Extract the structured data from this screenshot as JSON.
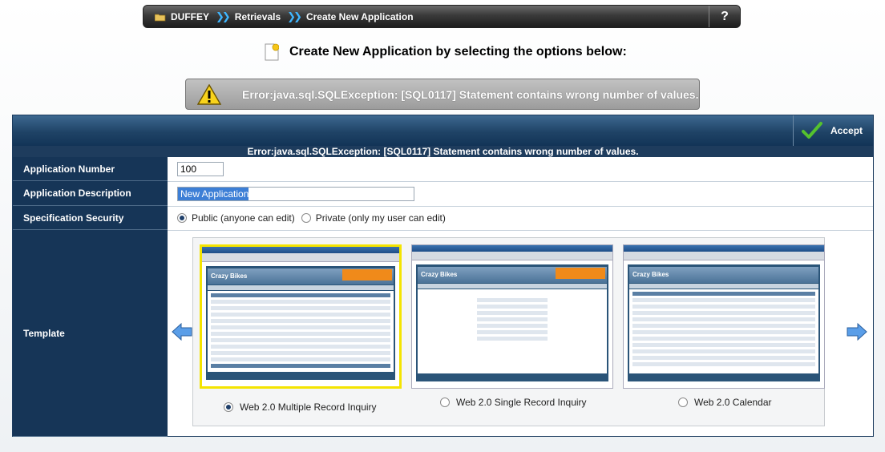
{
  "breadcrumb": {
    "items": [
      "DUFFEY",
      "Retrievals",
      "Create New Application"
    ],
    "separator": "»",
    "help_label": "?"
  },
  "page": {
    "title": "Create New Application by selecting the options below:"
  },
  "error": {
    "banner_message": "Error:java.sql.SQLException: [SQL0117] Statement contains wrong number of values.",
    "panel_message": "Error:java.sql.SQLException: [SQL0117] Statement contains wrong number of values."
  },
  "toolbar": {
    "accept_label": "Accept"
  },
  "form": {
    "app_number_label": "Application Number",
    "app_number_value": "100",
    "app_desc_label": "Application Description",
    "app_desc_value": "New Application",
    "security_label": "Specification Security",
    "security_options": [
      "Public (anyone can edit)",
      "Private (only my user can edit)"
    ],
    "security_selected": "Public (anyone can edit)",
    "template_label": "Template"
  },
  "templates": [
    {
      "name": "Web 2.0 Multiple Record Inquiry",
      "selected": true
    },
    {
      "name": "Web 2.0 Single Record Inquiry",
      "selected": false
    },
    {
      "name": "Web 2.0 Calendar",
      "selected": false
    }
  ],
  "colors": {
    "panel_dark": "#163557",
    "accent_blue": "#3fb6ff",
    "selected_border": "#f4e400",
    "check_green": "#4caf2a"
  },
  "icons": [
    "folder-icon",
    "chevron-right-icon",
    "help-icon",
    "document-icon",
    "warning-icon",
    "checkmark-icon",
    "arrow-left-icon",
    "arrow-right-icon"
  ]
}
